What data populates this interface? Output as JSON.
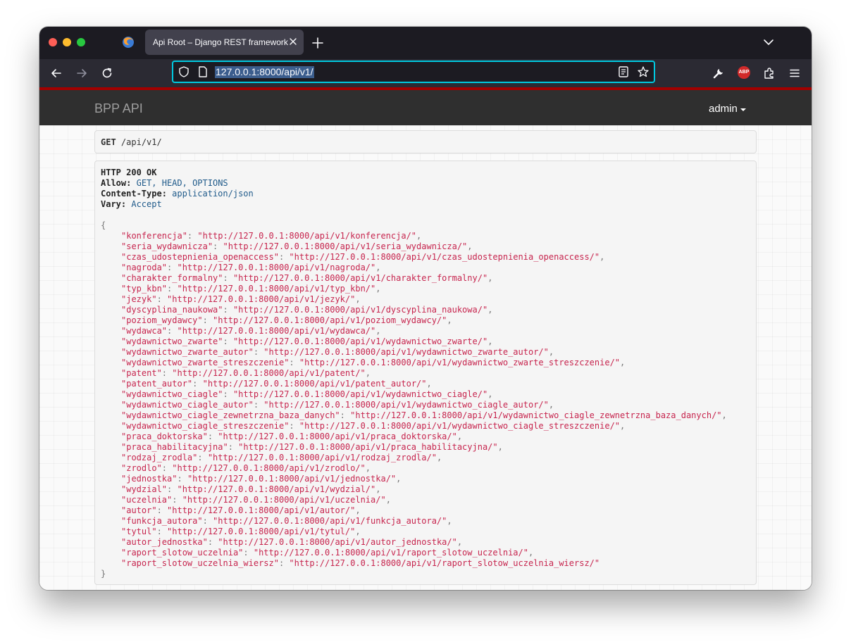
{
  "browser": {
    "tab_title": "Api Root – Django REST framework",
    "url": "127.0.0.1:8000/api/v1/"
  },
  "navbar": {
    "brand": "BPP API",
    "user": "admin"
  },
  "request": {
    "method": "GET",
    "path": "/api/v1/"
  },
  "response": {
    "status": "HTTP 200 OK",
    "headers": [
      {
        "name": "Allow:",
        "value": "GET, HEAD, OPTIONS"
      },
      {
        "name": "Content-Type:",
        "value": "application/json"
      },
      {
        "name": "Vary:",
        "value": "Accept"
      }
    ],
    "open_brace": "{",
    "close_brace": "}",
    "entries": [
      {
        "key": "\"konferencja\"",
        "value": "\"http://127.0.0.1:8000/api/v1/konferencja/\"",
        "sep": ","
      },
      {
        "key": "\"seria_wydawnicza\"",
        "value": "\"http://127.0.0.1:8000/api/v1/seria_wydawnicza/\"",
        "sep": ","
      },
      {
        "key": "\"czas_udostepnienia_openaccess\"",
        "value": "\"http://127.0.0.1:8000/api/v1/czas_udostepnienia_openaccess/\"",
        "sep": ","
      },
      {
        "key": "\"nagroda\"",
        "value": "\"http://127.0.0.1:8000/api/v1/nagroda/\"",
        "sep": ","
      },
      {
        "key": "\"charakter_formalny\"",
        "value": "\"http://127.0.0.1:8000/api/v1/charakter_formalny/\"",
        "sep": ","
      },
      {
        "key": "\"typ_kbn\"",
        "value": "\"http://127.0.0.1:8000/api/v1/typ_kbn/\"",
        "sep": ","
      },
      {
        "key": "\"jezyk\"",
        "value": "\"http://127.0.0.1:8000/api/v1/jezyk/\"",
        "sep": ","
      },
      {
        "key": "\"dyscyplina_naukowa\"",
        "value": "\"http://127.0.0.1:8000/api/v1/dyscyplina_naukowa/\"",
        "sep": ","
      },
      {
        "key": "\"poziom_wydawcy\"",
        "value": "\"http://127.0.0.1:8000/api/v1/poziom_wydawcy/\"",
        "sep": ","
      },
      {
        "key": "\"wydawca\"",
        "value": "\"http://127.0.0.1:8000/api/v1/wydawca/\"",
        "sep": ","
      },
      {
        "key": "\"wydawnictwo_zwarte\"",
        "value": "\"http://127.0.0.1:8000/api/v1/wydawnictwo_zwarte/\"",
        "sep": ","
      },
      {
        "key": "\"wydawnictwo_zwarte_autor\"",
        "value": "\"http://127.0.0.1:8000/api/v1/wydawnictwo_zwarte_autor/\"",
        "sep": ","
      },
      {
        "key": "\"wydawnictwo_zwarte_streszczenie\"",
        "value": "\"http://127.0.0.1:8000/api/v1/wydawnictwo_zwarte_streszczenie/\"",
        "sep": ","
      },
      {
        "key": "\"patent\"",
        "value": "\"http://127.0.0.1:8000/api/v1/patent/\"",
        "sep": ","
      },
      {
        "key": "\"patent_autor\"",
        "value": "\"http://127.0.0.1:8000/api/v1/patent_autor/\"",
        "sep": ","
      },
      {
        "key": "\"wydawnictwo_ciagle\"",
        "value": "\"http://127.0.0.1:8000/api/v1/wydawnictwo_ciagle/\"",
        "sep": ","
      },
      {
        "key": "\"wydawnictwo_ciagle_autor\"",
        "value": "\"http://127.0.0.1:8000/api/v1/wydawnictwo_ciagle_autor/\"",
        "sep": ","
      },
      {
        "key": "\"wydawnictwo_ciagle_zewnetrzna_baza_danych\"",
        "value": "\"http://127.0.0.1:8000/api/v1/wydawnictwo_ciagle_zewnetrzna_baza_danych/\"",
        "sep": ","
      },
      {
        "key": "\"wydawnictwo_ciagle_streszczenie\"",
        "value": "\"http://127.0.0.1:8000/api/v1/wydawnictwo_ciagle_streszczenie/\"",
        "sep": ","
      },
      {
        "key": "\"praca_doktorska\"",
        "value": "\"http://127.0.0.1:8000/api/v1/praca_doktorska/\"",
        "sep": ","
      },
      {
        "key": "\"praca_habilitacyjna\"",
        "value": "\"http://127.0.0.1:8000/api/v1/praca_habilitacyjna/\"",
        "sep": ","
      },
      {
        "key": "\"rodzaj_zrodla\"",
        "value": "\"http://127.0.0.1:8000/api/v1/rodzaj_zrodla/\"",
        "sep": ","
      },
      {
        "key": "\"zrodlo\"",
        "value": "\"http://127.0.0.1:8000/api/v1/zrodlo/\"",
        "sep": ","
      },
      {
        "key": "\"jednostka\"",
        "value": "\"http://127.0.0.1:8000/api/v1/jednostka/\"",
        "sep": ","
      },
      {
        "key": "\"wydzial\"",
        "value": "\"http://127.0.0.1:8000/api/v1/wydzial/\"",
        "sep": ","
      },
      {
        "key": "\"uczelnia\"",
        "value": "\"http://127.0.0.1:8000/api/v1/uczelnia/\"",
        "sep": ","
      },
      {
        "key": "\"autor\"",
        "value": "\"http://127.0.0.1:8000/api/v1/autor/\"",
        "sep": ","
      },
      {
        "key": "\"funkcja_autora\"",
        "value": "\"http://127.0.0.1:8000/api/v1/funkcja_autora/\"",
        "sep": ","
      },
      {
        "key": "\"tytul\"",
        "value": "\"http://127.0.0.1:8000/api/v1/tytul/\"",
        "sep": ","
      },
      {
        "key": "\"autor_jednostka\"",
        "value": "\"http://127.0.0.1:8000/api/v1/autor_jednostka/\"",
        "sep": ","
      },
      {
        "key": "\"raport_slotow_uczelnia\"",
        "value": "\"http://127.0.0.1:8000/api/v1/raport_slotow_uczelnia/\"",
        "sep": ","
      },
      {
        "key": "\"raport_slotow_uczelnia_wiersz\"",
        "value": "\"http://127.0.0.1:8000/api/v1/raport_slotow_uczelnia_wiersz/\"",
        "sep": ""
      }
    ]
  },
  "colors": {
    "json_string": "#c7254e",
    "header_value": "#1f5a8a",
    "accent_line": "#a30000",
    "url_focus": "#00c9e0"
  },
  "icons": [
    "firefox-icon",
    "tab-close-icon",
    "new-tab-icon",
    "tab-list-icon",
    "back-icon",
    "forward-icon",
    "reload-icon",
    "shield-icon",
    "page-icon",
    "reader-view-icon",
    "bookmark-star-icon",
    "wrench-icon",
    "adblock-icon",
    "extensions-icon",
    "menu-icon"
  ]
}
